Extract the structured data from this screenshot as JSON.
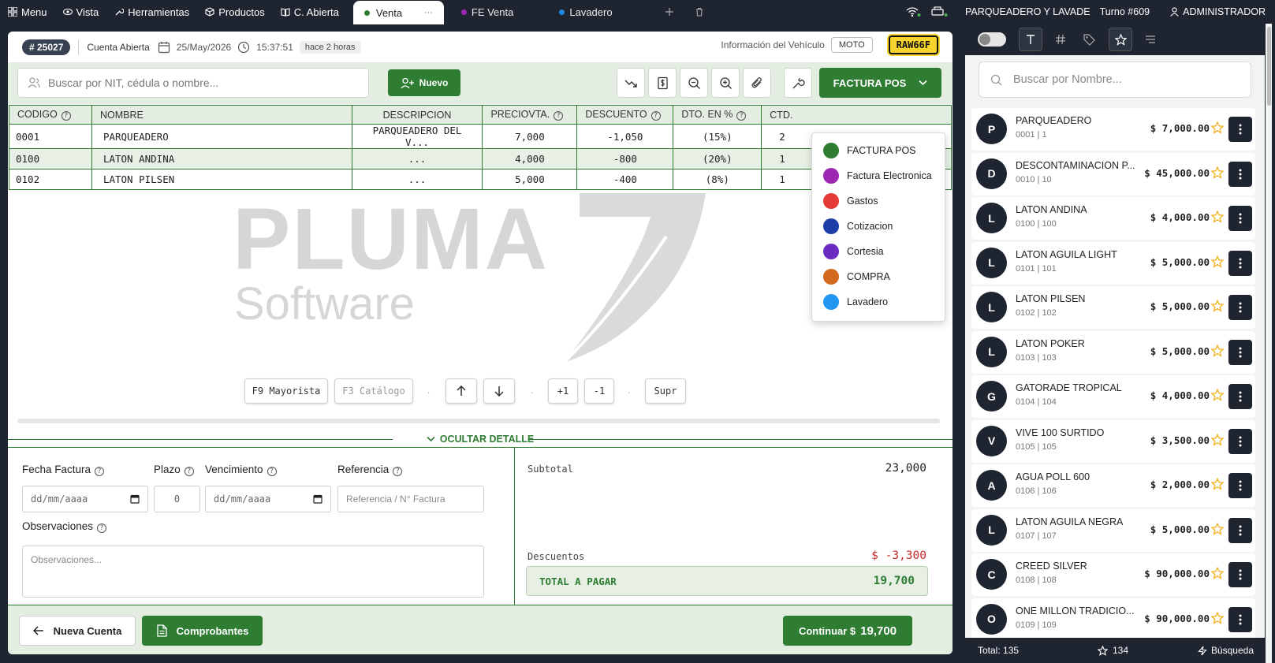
{
  "topbar": {
    "menu": "Menu",
    "vista": "Vista",
    "herramientas": "Herramientas",
    "productos": "Productos",
    "c_abierta": "C. Abierta",
    "tabs": [
      {
        "label": "Venta",
        "dot": "#2e7d32"
      },
      {
        "label": "FE Venta",
        "dot": "#9c27b0"
      },
      {
        "label": "Lavadero",
        "dot": "#1e88e5"
      }
    ],
    "active_tab_more": "···",
    "company": "PARQUEADERO Y LAVADE",
    "turno": "Turno #609",
    "user": "ADMINISTRADOR"
  },
  "account": {
    "number": "# 25027",
    "status": "Cuenta Abierta",
    "date": "25/May/2026",
    "time": "15:37:51",
    "ago": "hace 2 horas",
    "vehicle_label": "Información del Vehículo",
    "vehicle_type": "MOTO",
    "plate": "RAW66F"
  },
  "customer": {
    "search_placeholder": "Buscar por NIT, cédula o nombre...",
    "new_label": "Nuevo"
  },
  "doc_type": {
    "selected": "FACTURA POS",
    "options": [
      {
        "label": "FACTURA POS",
        "color": "#2e7d32"
      },
      {
        "label": "Factura Electronica",
        "color": "#9c27b0"
      },
      {
        "label": "Gastos",
        "color": "#e53935"
      },
      {
        "label": "Cotizacion",
        "color": "#1e3fa8"
      },
      {
        "label": "Cortesia",
        "color": "#6a2cc0"
      },
      {
        "label": "COMPRA",
        "color": "#d2691e"
      },
      {
        "label": "Lavadero",
        "color": "#2196f3"
      }
    ]
  },
  "table": {
    "headers": {
      "codigo": "CODIGO",
      "nombre": "NOMBRE",
      "descripcion": "DESCRIPCION",
      "precio": "PRECIOVTA.",
      "descuento": "DESCUENTO",
      "dto": "DTO. EN %",
      "ctd": "CTD."
    },
    "rows": [
      {
        "codigo": "0001",
        "nombre": "PARQUEADERO",
        "descripcion": "PARQUEADERO DEL V...",
        "precio": "7,000",
        "descuento": "-1,050",
        "dto": "(15%)",
        "ctd": "2"
      },
      {
        "codigo": "0100",
        "nombre": "LATON ANDINA",
        "descripcion": "...",
        "precio": "4,000",
        "descuento": "-800",
        "dto": "(20%)",
        "ctd": "1"
      },
      {
        "codigo": "0102",
        "nombre": "LATON PILSEN",
        "descripcion": "...",
        "precio": "5,000",
        "descuento": "-400",
        "dto": "(8%)",
        "ctd": "1"
      }
    ]
  },
  "watermark": {
    "line1": "PLUMA",
    "line2": "Software"
  },
  "keys": {
    "mayorista": "F9 Mayorista",
    "catalogo": "F3 Catálogo",
    "plus": "+1",
    "minus": "-1",
    "supr": "Supr",
    "dot": "."
  },
  "detail_toggle": "OCULTAR DETALLE",
  "invoice": {
    "fecha_label": "Fecha Factura",
    "fecha_value": "dd/mm/aaaa",
    "plazo_label": "Plazo",
    "plazo_value": "0",
    "venc_label": "Vencimiento",
    "venc_value": "dd/mm/aaaa",
    "ref_label": "Referencia",
    "ref_placeholder": "Referencia / N° Factura",
    "obs_label": "Observaciones",
    "obs_placeholder": "Observaciones..."
  },
  "totals": {
    "subtotal_label": "Subtotal",
    "subtotal": "23,000",
    "descuentos_label": "Descuentos",
    "descuentos": "$ -3,300",
    "total_label": "TOTAL A PAGAR",
    "total": "19,700"
  },
  "footer": {
    "nueva_cuenta": "Nueva Cuenta",
    "comprobantes": "Comprobantes",
    "continuar_label": "Continuar $",
    "continuar_value": "19,700"
  },
  "products": {
    "search_placeholder": "Buscar por Nombre...",
    "items": [
      {
        "initial": "P",
        "name": "PARQUEADERO",
        "code": "0001 | 1",
        "price": "$ 7,000.00"
      },
      {
        "initial": "D",
        "name": "DESCONTAMINACION P...",
        "code": "0010 | 10",
        "price": "$ 45,000.00"
      },
      {
        "initial": "L",
        "name": "LATON ANDINA",
        "code": "0100 | 100",
        "price": "$ 4,000.00"
      },
      {
        "initial": "L",
        "name": "LATON AGUILA LIGHT",
        "code": "0101 | 101",
        "price": "$ 5,000.00"
      },
      {
        "initial": "L",
        "name": "LATON PILSEN",
        "code": "0102 | 102",
        "price": "$ 5,000.00"
      },
      {
        "initial": "L",
        "name": "LATON POKER",
        "code": "0103 | 103",
        "price": "$ 5,000.00"
      },
      {
        "initial": "G",
        "name": "GATORADE TROPICAL",
        "code": "0104 | 104",
        "price": "$ 4,000.00"
      },
      {
        "initial": "V",
        "name": "VIVE 100 SURTIDO",
        "code": "0105 | 105",
        "price": "$ 3,500.00"
      },
      {
        "initial": "A",
        "name": "AGUA POLL 600",
        "code": "0106 | 106",
        "price": "$ 2,000.00"
      },
      {
        "initial": "L",
        "name": "LATON AGUILA NEGRA",
        "code": "0107 | 107",
        "price": "$ 5,000.00"
      },
      {
        "initial": "C",
        "name": "CREED SILVER",
        "code": "0108 | 108",
        "price": "$ 90,000.00"
      },
      {
        "initial": "O",
        "name": "ONE MILLON TRADICIO...",
        "code": "0109 | 109",
        "price": "$ 90,000.00"
      }
    ],
    "total_label": "Total: 135",
    "fav_count": "134",
    "search_mode": "Búsqueda"
  }
}
